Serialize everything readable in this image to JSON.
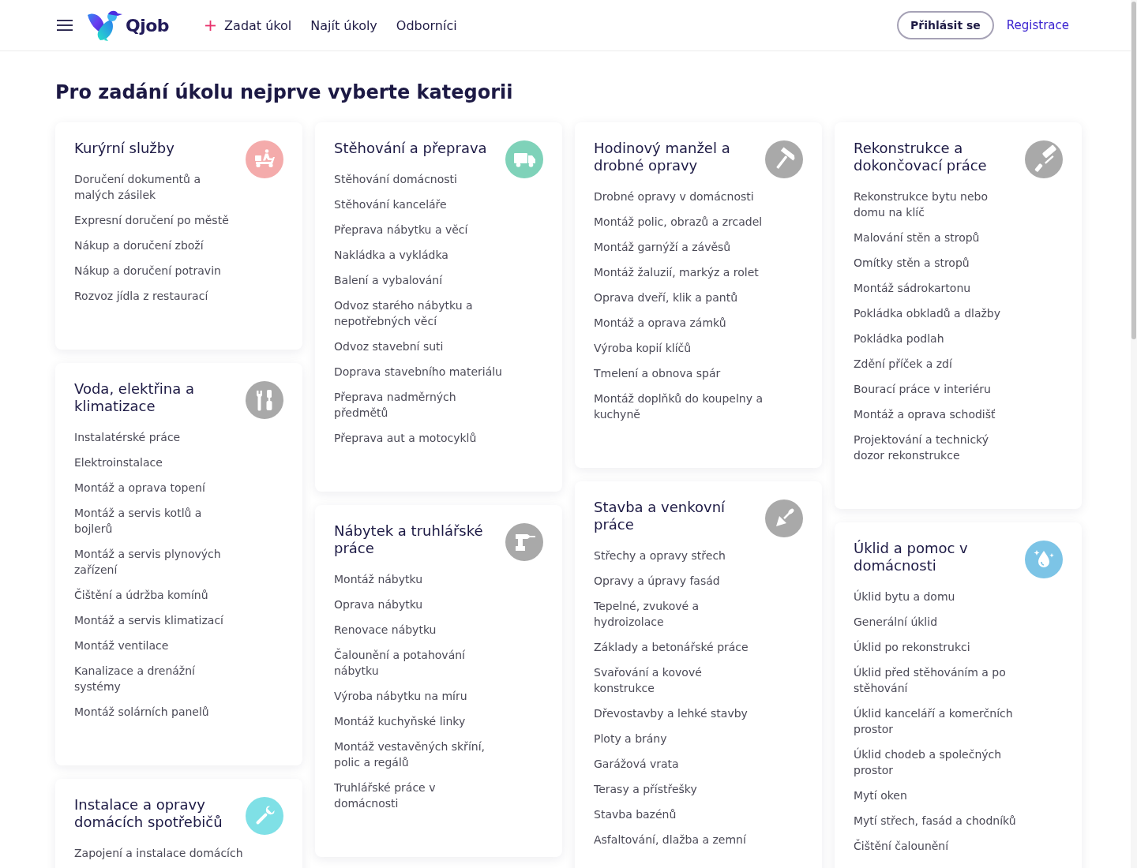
{
  "header": {
    "logo_text": "Qjob",
    "nav": [
      {
        "kind": "add",
        "label": "Zadat úkol"
      },
      {
        "kind": "link",
        "label": "Najít úkoly"
      },
      {
        "kind": "link",
        "label": "Odborníci"
      }
    ],
    "login_button": "Přihlásit se",
    "register_link": "Registrace"
  },
  "title": "Pro zadání úkolu nejprve vyberte kategorii",
  "categories": [
    {
      "title": "Kurýrní služby",
      "color": "#f4abab",
      "items": [
        "Doručení dokumentů a malých zásilek",
        "Expresní doručení po městě",
        "Nákup a doručení zboží",
        "Nákup a doručení potravin",
        "Rozvoz jídla z restaurací"
      ]
    },
    {
      "title": "Stěhování a přeprava",
      "color": "#7fd2b9",
      "items": [
        "Stěhování domácnosti",
        "Stěhování kanceláře",
        "Přeprava nábytku a věcí",
        "Nakládka a vykládka",
        "Balení a vybalování",
        "Odvoz starého nábytku a nepotřebných věcí",
        "Odvoz stavební suti",
        "Doprava stavebního materiálu",
        "Přeprava nadměrných předmětů",
        "Přeprava aut a motocyklů"
      ]
    },
    {
      "title": "Hodinový manžel a drobné opravy",
      "color": "#a9a9a9",
      "items": [
        "Drobné opravy v domácnosti",
        "Montáž polic, obrazů a zrcadel",
        "Montáž garnýží a závěsů",
        "Montáž žaluzií, markýz a rolet",
        "Oprava dveří, klik a pantů",
        "Montáž a oprava zámků",
        "Výroba kopií klíčů",
        "Tmelení a obnova spár",
        "Montáž doplňků do koupelny a kuchyně"
      ]
    },
    {
      "title": "Rekonstrukce a dokončovací práce",
      "color": "#a9a9a9",
      "items": [
        "Rekonstrukce bytu nebo domu na klíč",
        "Malování stěn a stropů",
        "Omítky stěn a stropů",
        "Montáž sádrokartonu",
        "Pokládka obkladů a dlažby",
        "Pokládka podlah",
        "Zdění příček a zdí",
        "Bourací práce v interiéru",
        "Montáž a oprava schodišť",
        "Projektování a technický dozor rekonstrukce"
      ]
    },
    {
      "title": "Voda, elektřina a klimatizace",
      "color": "#a9a9a9",
      "items": [
        "Instalatérské práce",
        "Elektroinstalace",
        "Montáž a oprava topení",
        "Montáž a servis kotlů a bojlerů",
        "Montáž a servis plynových zařízení",
        "Čištění a údržba komínů",
        "Montáž a servis klimatizací",
        "Montáž ventilace",
        "Kanalizace a drenážní systémy",
        "Montáž solárních panelů"
      ]
    },
    {
      "title": "Nábytek a truhlářské práce",
      "color": "#a9a9a9",
      "items": [
        "Montáž nábytku",
        "Oprava nábytku",
        "Renovace nábytku",
        "Čalounění a potahování nábytku",
        "Výroba nábytku na míru",
        "Montáž kuchyňské linky",
        "Montáž vestavěných skříní, polic a regálů",
        "Truhlářské práce v domácnosti"
      ]
    },
    {
      "title": "Stavba a venkovní práce",
      "color": "#a9a9a9",
      "items": [
        "Střechy a opravy střech",
        "Opravy a úpravy fasád",
        "Tepelné, zvukové a hydroizolace",
        "Základy a betonářské práce",
        "Svařování a kovové konstrukce",
        "Dřevostavby a lehké stavby",
        "Ploty a brány",
        "Garážová vrata",
        "Terasy a přístřešky",
        "Stavba bazénů",
        "Asfaltování, dlažba a zemní"
      ]
    },
    {
      "title": "Úklid a pomoc v domácnosti",
      "color": "#7cc4e6",
      "items": [
        "Úklid bytu a domu",
        "Generální úklid",
        "Úklid po rekonstrukci",
        "Úklid před stěhováním a po stěhování",
        "Úklid kanceláří a komerčních prostor",
        "Úklid chodeb a společných prostor",
        "Mytí oken",
        "Mytí střech, fasád a chodníků",
        "Čištění čalounění"
      ]
    },
    {
      "title": "Instalace a opravy domácích spotřebičů",
      "color": "#7fe0e6",
      "items": [
        "Zapojení a instalace domácích"
      ]
    }
  ]
}
